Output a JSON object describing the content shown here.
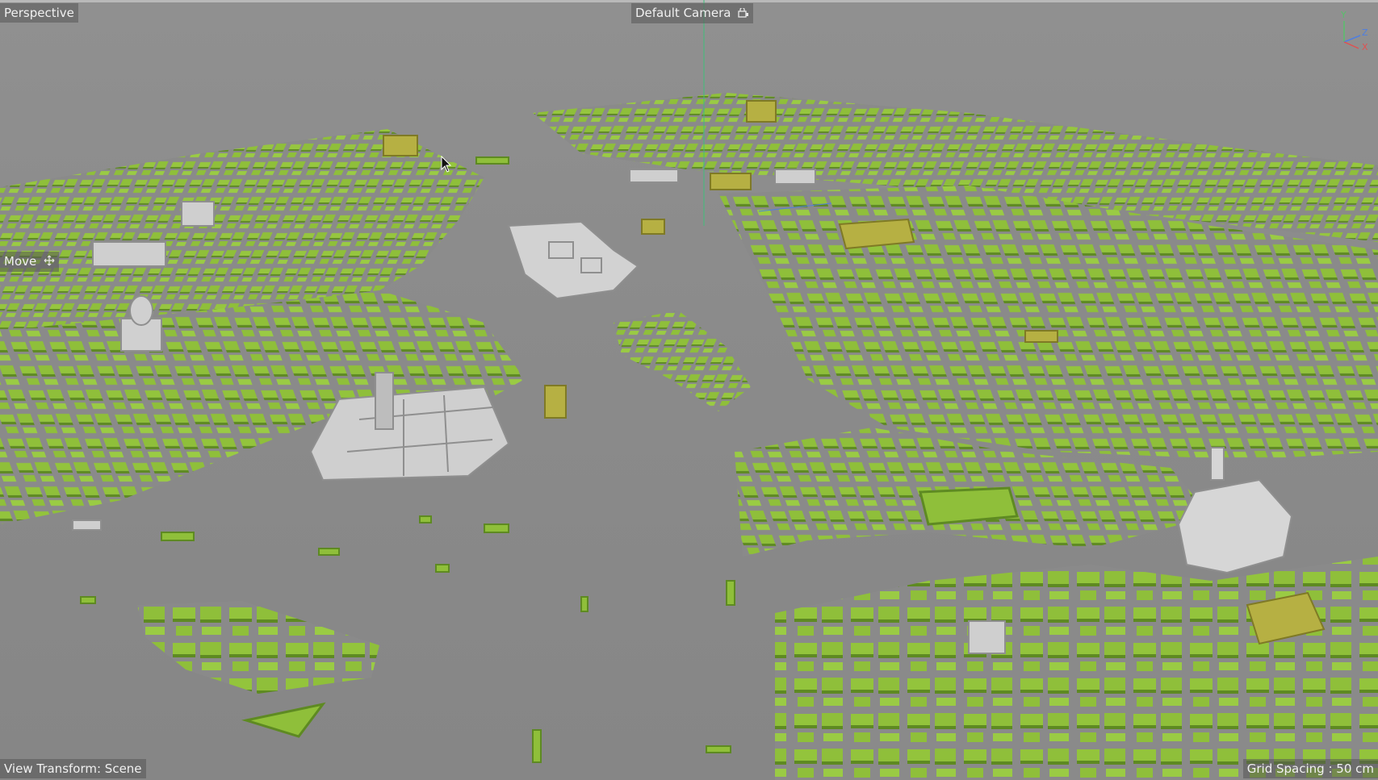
{
  "viewport": {
    "projection_label": "Perspective",
    "camera_label": "Default Camera",
    "tool_label": "Move",
    "view_transform_label": "View Transform: Scene",
    "grid_spacing_label": "Grid Spacing : 50 cm"
  },
  "axis_gizmo": {
    "y": "Y",
    "z": "Z",
    "x": "X"
  },
  "icons": {
    "camera_lock": "camera-lock-icon",
    "move": "move-arrows-icon",
    "cursor": "mouse-pointer-icon"
  },
  "colors": {
    "background": "#8c8c8c",
    "building_green": "#8fbf3a",
    "building_green_shadow": "#5f8a22",
    "building_grey": "#c8c8c8",
    "building_yellow": "#b6b043",
    "hud_text": "#f0f0f0",
    "axis_y": "#58c06a",
    "axis_z": "#4f7fe0",
    "axis_x": "#e05050"
  }
}
